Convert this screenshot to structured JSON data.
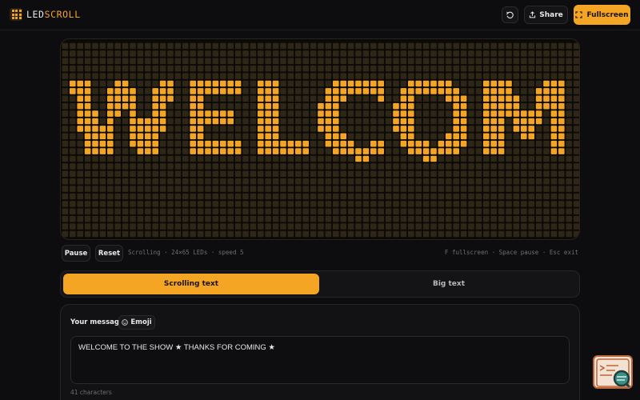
{
  "header": {
    "brand_part1": "LED",
    "brand_part2": "SCROLL",
    "share_label": "Share",
    "fullscreen_label": "Fullscreen"
  },
  "display": {
    "text": "WELCOM",
    "led_color": "#f5a524",
    "led_off_color": "#2e2616"
  },
  "controls": {
    "pause_label": "Pause",
    "reset_label": "Reset",
    "status": "Scrolling · 24×65 LEDs · speed 5",
    "hints": "F fullscreen · Space pause · Esc exit"
  },
  "tabs": [
    {
      "label": "Scrolling text"
    },
    {
      "label": "Big text"
    }
  ],
  "message": {
    "label": "Your message",
    "emoji_label": "Emoji",
    "value": "WELCOME TO THE SHOW ★ THANKS FOR COMING ★",
    "char_count": "41 characters"
  },
  "colors": {
    "accent": "#f5a524",
    "background": "#0d0d0f"
  }
}
